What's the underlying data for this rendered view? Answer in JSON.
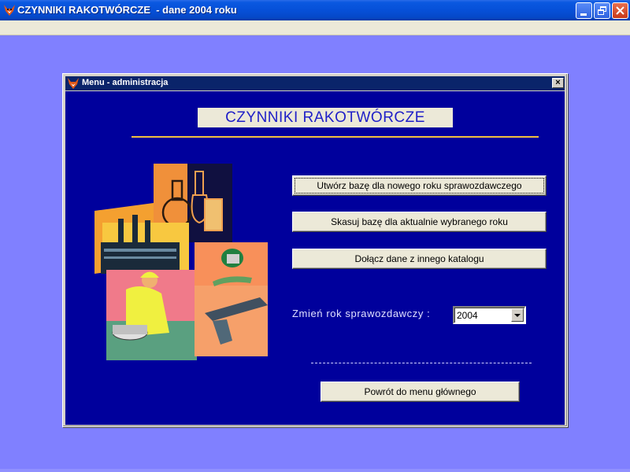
{
  "main_window": {
    "title": "CZYNNIKI RAKOTWÓRCZE  - dane 2004 roku",
    "icon": "fox-app-icon"
  },
  "dialog": {
    "title": "Menu - administracja",
    "close_label": "×",
    "heading": "CZYNNIKI RAKOTWÓRCZE",
    "buttons": {
      "create_db": "Utwórz bazę dla nowego roku sprawozdawczego",
      "delete_db": "Skasuj bazę dla aktualnie wybranego roku",
      "attach_data": "Dołącz dane z innego katalogu",
      "back_to_main": "Powrót do menu głównego"
    },
    "year_label": "Zmień rok sprawozdawczy :",
    "year_value": "2004"
  },
  "colors": {
    "desktop": "#8080ff",
    "dialog_body": "#00009c",
    "heading_text": "#2020c8",
    "heading_line": "#f0c040"
  }
}
